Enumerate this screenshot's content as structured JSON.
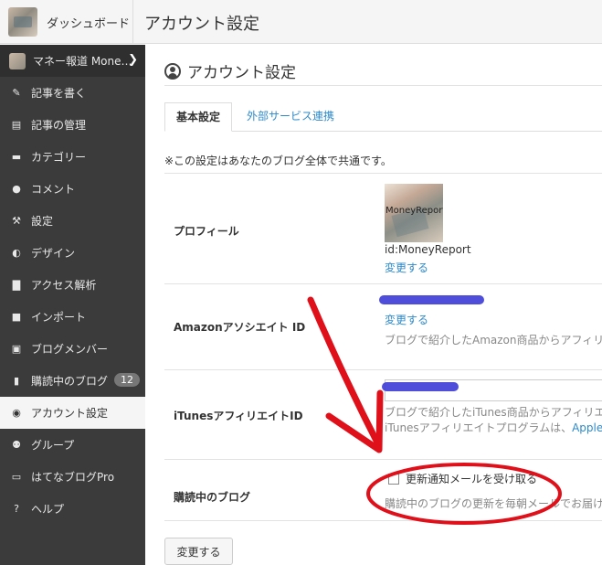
{
  "header": {
    "dashboard_label": "ダッシュボード",
    "page_title": "アカウント設定"
  },
  "sidebar": {
    "items": [
      {
        "label": "マネー報道 Mone…",
        "icon": "blog-thumbnail"
      },
      {
        "label": "記事を書く",
        "icon": "pencil-icon"
      },
      {
        "label": "記事の管理",
        "icon": "document-icon"
      },
      {
        "label": "カテゴリー",
        "icon": "folder-icon"
      },
      {
        "label": "コメント",
        "icon": "comment-icon"
      },
      {
        "label": "設定",
        "icon": "wrench-icon"
      },
      {
        "label": "デザイン",
        "icon": "palette-icon"
      },
      {
        "label": "アクセス解析",
        "icon": "bar-chart-icon"
      },
      {
        "label": "インポート",
        "icon": "truck-icon"
      },
      {
        "label": "ブログメンバー",
        "icon": "member-icon"
      },
      {
        "label": "購読中のブログ",
        "icon": "bookmark-icon",
        "badge": "12"
      },
      {
        "label": "アカウント設定",
        "icon": "user-circle-icon"
      },
      {
        "label": "グループ",
        "icon": "group-icon"
      },
      {
        "label": "はてなブログPro",
        "icon": "pro-icon"
      },
      {
        "label": "ヘルプ",
        "icon": "help-icon"
      }
    ]
  },
  "main": {
    "title": "アカウント設定",
    "tabs": [
      {
        "label": "基本設定",
        "active": true
      },
      {
        "label": "外部サービス連携",
        "active": false
      }
    ],
    "note": "※この設定はあなたのブログ全体で共通です。",
    "profile": {
      "label": "プロフィール",
      "image_text": "MoneyReport",
      "id_text": "id:MoneyReport",
      "change_link": "変更する"
    },
    "amazon": {
      "label": "Amazonアソシエイト ID",
      "change_link": "変更する",
      "help": "ブログで紹介したAmazon商品からアフィリ"
    },
    "itunes": {
      "label": "iTunesアフィリエイトID",
      "help1": "ブログで紹介したiTunes商品からアフィリエ",
      "help2_prefix": "iTunesアフィリエイトプログラムは、",
      "help2_link": "Apple"
    },
    "subscription": {
      "label": "購読中のブログ",
      "checkbox_label": "更新通知メールを受け取る",
      "checked": false,
      "help": "購読中のブログの更新を毎朝メールでお届け"
    },
    "save_button": "変更する"
  },
  "colors": {
    "sidebar_bg": "#3b3b3b",
    "link": "#2e8ac9",
    "annotation_red": "#e0101a",
    "redaction_blue": "#3b3bd6"
  }
}
